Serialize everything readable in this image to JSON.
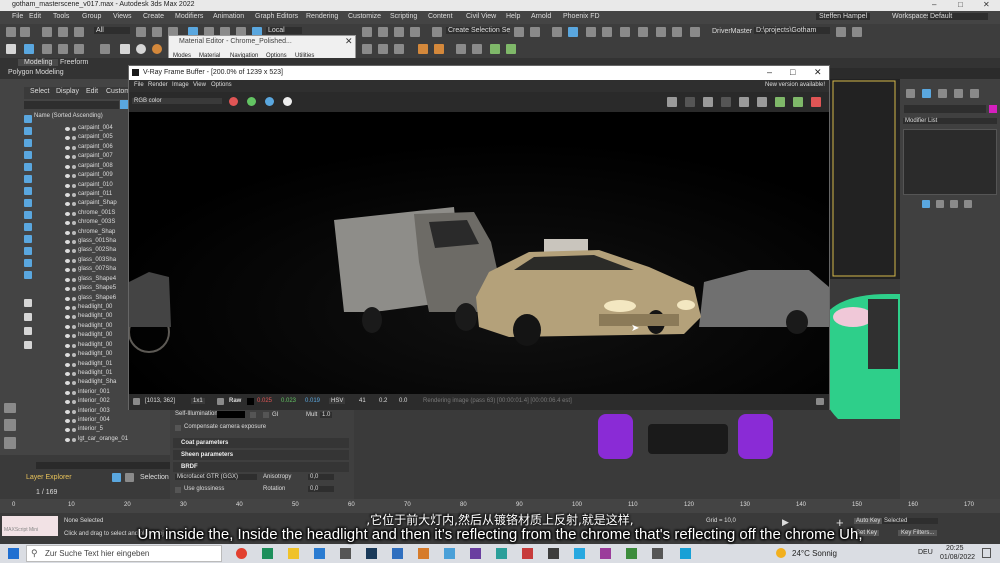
{
  "app": {
    "title": "gotham_masterscene_v017.max - Autodesk 3ds Max 2022"
  },
  "menu": [
    "File",
    "Edit",
    "Tools",
    "Group",
    "Views",
    "Create",
    "Modifiers",
    "Animation",
    "Graph Editors",
    "Rendering",
    "Customize",
    "Scripting",
    "Content",
    "Civil View",
    "Help",
    "Arnold",
    "Phoenix FD"
  ],
  "user": {
    "name": "Steffen Hampel",
    "workspaces_label": "Workspaces:",
    "workspace": "Default"
  },
  "toolbar": {
    "filter": "All",
    "coord": "Local",
    "selection_set": "Create Selection Se",
    "driver_master": "DriverMaster",
    "path": "D:\\projects\\Gotham"
  },
  "ribbon": {
    "tabs": [
      "Modeling",
      "Freeform"
    ],
    "sub": "Polygon Modeling"
  },
  "material_editor": {
    "title": "Material Editor - Chrome_Polished...",
    "menu": [
      "Modes",
      "Material",
      "Navigation",
      "Options",
      "Utilities"
    ]
  },
  "scene_explorer": {
    "tabs": [
      "Select",
      "Display",
      "Edit",
      "Custom"
    ],
    "column": "Name (Sorted Ascending)",
    "rows": [
      "carpaint_004",
      "carpaint_005",
      "carpaint_006",
      "carpaint_007",
      "carpaint_008",
      "carpaint_009",
      "carpaint_010",
      "carpaint_011",
      "carpaint_Shap",
      "chrome_001S",
      "chrome_003S",
      "chrome_Shap",
      "glass_001Sha",
      "glass_002Sha",
      "glass_003Sha",
      "glass_007Sha",
      "glass_Shape4",
      "glass_Shape5",
      "glass_Shape6",
      "headlight_00",
      "headlight_00",
      "headlight_00",
      "headlight_00",
      "headlight_00",
      "headlight_00",
      "headlight_01",
      "headlight_01",
      "headlight_Sha",
      "interior_001",
      "interior_002",
      "interior_003",
      "interior_004",
      "interior_5",
      "lgt_car_orange_01"
    ],
    "layer_label": "Layer Explorer",
    "selection_label": "Selection S",
    "frame": "1 / 169"
  },
  "vfb": {
    "title": "V-Ray Frame Buffer - [200.0% of 1239 x 523]",
    "menu": [
      "File",
      "Render",
      "Image",
      "View",
      "Options"
    ],
    "notice": "New version available!",
    "channel": "RGB color",
    "status": {
      "coords": "[1013, 362]",
      "zoom": "1x1",
      "raw": "Raw",
      "r": "0.025",
      "g": "0.023",
      "b": "0.019",
      "mode": "HSV",
      "h": "41",
      "s": "0.2",
      "v": "0.0",
      "msg": "Rendering image (pass 63) [00:00:01.4] [00:00:06.4 est]"
    }
  },
  "material_panel": {
    "self_illum": "Self-Illumination",
    "mult_label": "Mult",
    "mult": "1.0",
    "compensate": "Compensate camera exposure",
    "sections": [
      "Coat parameters",
      "Sheen parameters",
      "BRDF"
    ],
    "brdf": "Microfacet GTR (GGX)",
    "anisotropy_label": "Anisotropy",
    "anisotropy": "0,0",
    "use_glossiness": "Use glossiness",
    "rotation_label": "Rotation",
    "rotation": "0,0"
  },
  "modifier_list": "Modifier List",
  "status": {
    "none_selected": "None Selected",
    "hint": "Click and drag to select and place obj",
    "maxscript": "MAXScript Mini",
    "grid": "Grid = 10,0",
    "add_key": "Auto Key",
    "selected": "Selected",
    "set_key": "Set Key",
    "key_filters": "Key Filters..."
  },
  "timeline_ticks": [
    "0",
    "10",
    "20",
    "30",
    "40",
    "50",
    "60",
    "70",
    "80",
    "90",
    "100",
    "110",
    "120",
    "130",
    "140",
    "150",
    "160",
    "170"
  ],
  "subtitles": {
    "cn": ",它位于前大灯内,然后从镀铬材质上反射,就是这样,",
    "en": "Um inside the, Inside the headlight and then it's reflecting from the chrome that's reflecting off the chrome Uh,"
  },
  "taskbar": {
    "search": "Zur Suche Text hier eingeben",
    "weather": "24°C Sonnig",
    "lang": "DEU",
    "time": "20:25",
    "date": "01/08/2022"
  },
  "colors": {
    "accent": "#5aa7df",
    "car_green": "#2ecf8a",
    "car_purple": "#8a2bd6"
  }
}
